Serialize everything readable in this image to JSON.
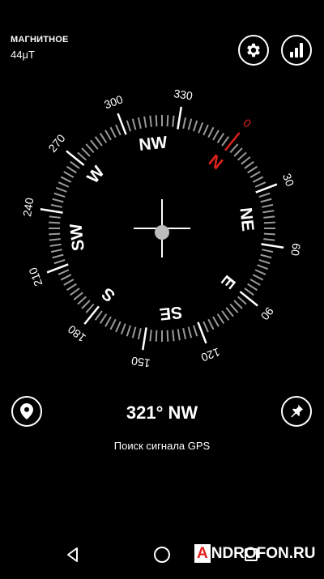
{
  "magnetic": {
    "label": "МАГНИТНОЕ",
    "value": "44μT"
  },
  "top_buttons": [
    {
      "name": "settings",
      "icon": "gear-icon"
    },
    {
      "name": "signal-strength",
      "icon": "signal-bars-icon"
    }
  ],
  "compass": {
    "heading_degrees": 321,
    "cardinals": [
      "N",
      "NE",
      "E",
      "SE",
      "S",
      "SW",
      "W",
      "NW"
    ],
    "north_color": "#e0201b",
    "degree_labels": [
      "0",
      "30",
      "60",
      "90",
      "120",
      "150",
      "180",
      "210",
      "240",
      "270",
      "300",
      "330"
    ]
  },
  "heading_text": "321° NW",
  "gps_status": "Поиск сигнала GPS",
  "bottom_buttons": [
    {
      "name": "location",
      "icon": "map-pin-icon"
    },
    {
      "name": "pin",
      "icon": "pushpin-icon"
    }
  ],
  "navbar": {
    "icons": [
      "back-icon",
      "home-icon",
      "recents-icon"
    ]
  },
  "watermark": {
    "first": "A",
    "rest": "NDROFON.RU"
  }
}
